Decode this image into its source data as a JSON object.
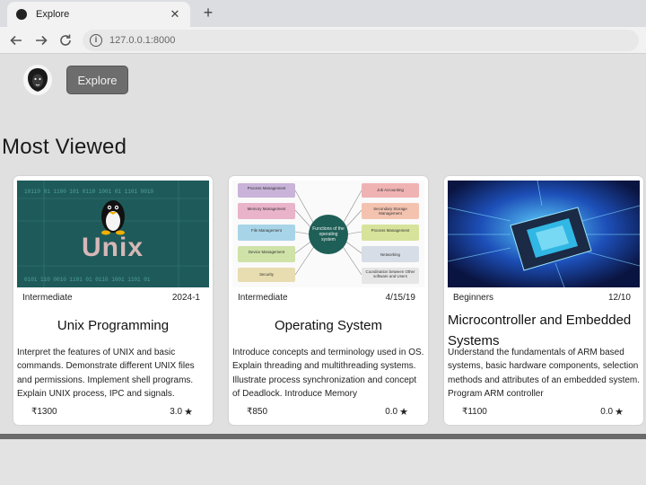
{
  "browser": {
    "tab_title": "Explore",
    "tab_close": "✕",
    "new_tab": "+",
    "url": "127.0.0.1:8000"
  },
  "header": {
    "explore_label": "Explore"
  },
  "section_title": "Most Viewed",
  "cards": [
    {
      "level": "Intermediate",
      "date": "2024-1",
      "title": "Unix Programming",
      "description": "Interpret the features of UNIX and basic commands. Demonstrate different UNIX files and permissions. Implement shell programs. Explain UNIX process, IPC and signals.",
      "price": "₹1300",
      "rating": "3.0",
      "image_label": "Unix"
    },
    {
      "level": "Intermediate",
      "date": "4/15/19",
      "title": "Operating System",
      "description": "Introduce concepts and terminology used in OS. Explain threading and multithreading systems. Illustrate process synchronization and concept of Deadlock. Introduce Memory",
      "price": "₹850",
      "rating": "0.0",
      "image_center": "Functions of the operating system",
      "image_nodes_left": [
        "Process Management",
        "Memory Management",
        "File Management",
        "Device Management",
        "Security"
      ],
      "image_nodes_right": [
        "Job Accounting",
        "Secondary Storage Management",
        "Process Management",
        "Networking",
        "Coordination between Other software and Users"
      ]
    },
    {
      "level": "Beginners",
      "date": "12/10",
      "title": "Microcontroller and Embedded Systems",
      "description": "Understand the fundamentals of ARM based systems, basic hardware components, selection methods and attributes of an embedded system. Program ARM controller",
      "price": "₹1100",
      "rating": "0.0"
    }
  ],
  "colors": {
    "page_bg": "#e0e0e0",
    "button_bg": "#6d6d6d",
    "tux_bg": "#1f5a5a"
  }
}
